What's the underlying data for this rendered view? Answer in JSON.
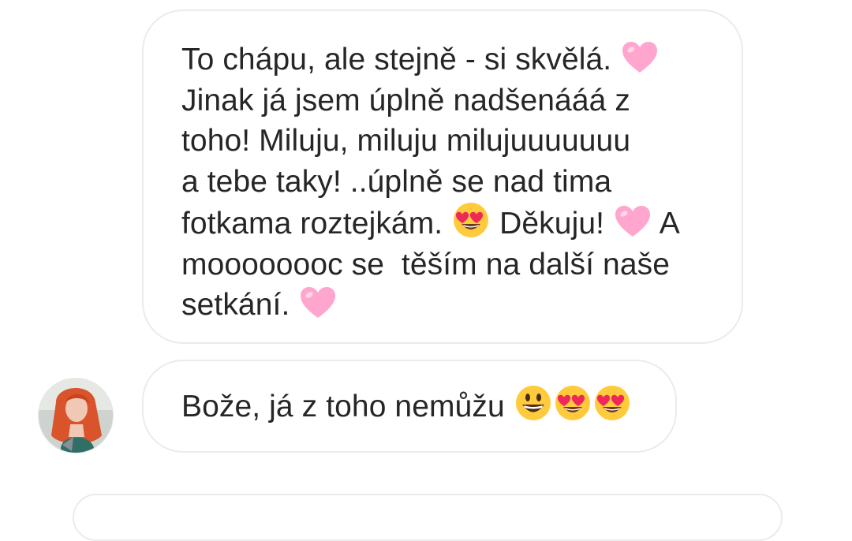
{
  "messages": [
    {
      "sender": "self",
      "lines": [
        [
          "To chápu, ale stejně - si skvělá. ",
          {
            "emoji": "pink-heart-icon"
          }
        ],
        [
          "Jinak já jsem úplně nadšenááá z"
        ],
        [
          "toho! Miluju, miluju milujuuuuuuu"
        ],
        [
          "a tebe taky! ..úplně se nad tima"
        ],
        [
          "fotkama roztejkám. ",
          {
            "emoji": "heart-eyes-icon"
          },
          " Děkuju! ",
          {
            "emoji": "pink-heart-icon"
          },
          " A"
        ],
        [
          "moooooooc se  těším na další naše"
        ],
        [
          "setkání. ",
          {
            "emoji": "pink-heart-icon"
          }
        ]
      ]
    },
    {
      "sender": "contact",
      "lines": [
        [
          "Bože, já z toho nemůžu ",
          {
            "emoji": "grinning-face-icon"
          },
          {
            "emoji": "heart-eyes-icon"
          },
          {
            "emoji": "heart-eyes-icon"
          }
        ]
      ]
    }
  ],
  "contact": {
    "avatar_icon": "contact-avatar"
  },
  "colors": {
    "bubble_border": "#ebebeb",
    "text": "#262626",
    "heart": "#ffa6cf",
    "emoji_face": "#ffcb3d",
    "emoji_heart": "#f0285a"
  }
}
